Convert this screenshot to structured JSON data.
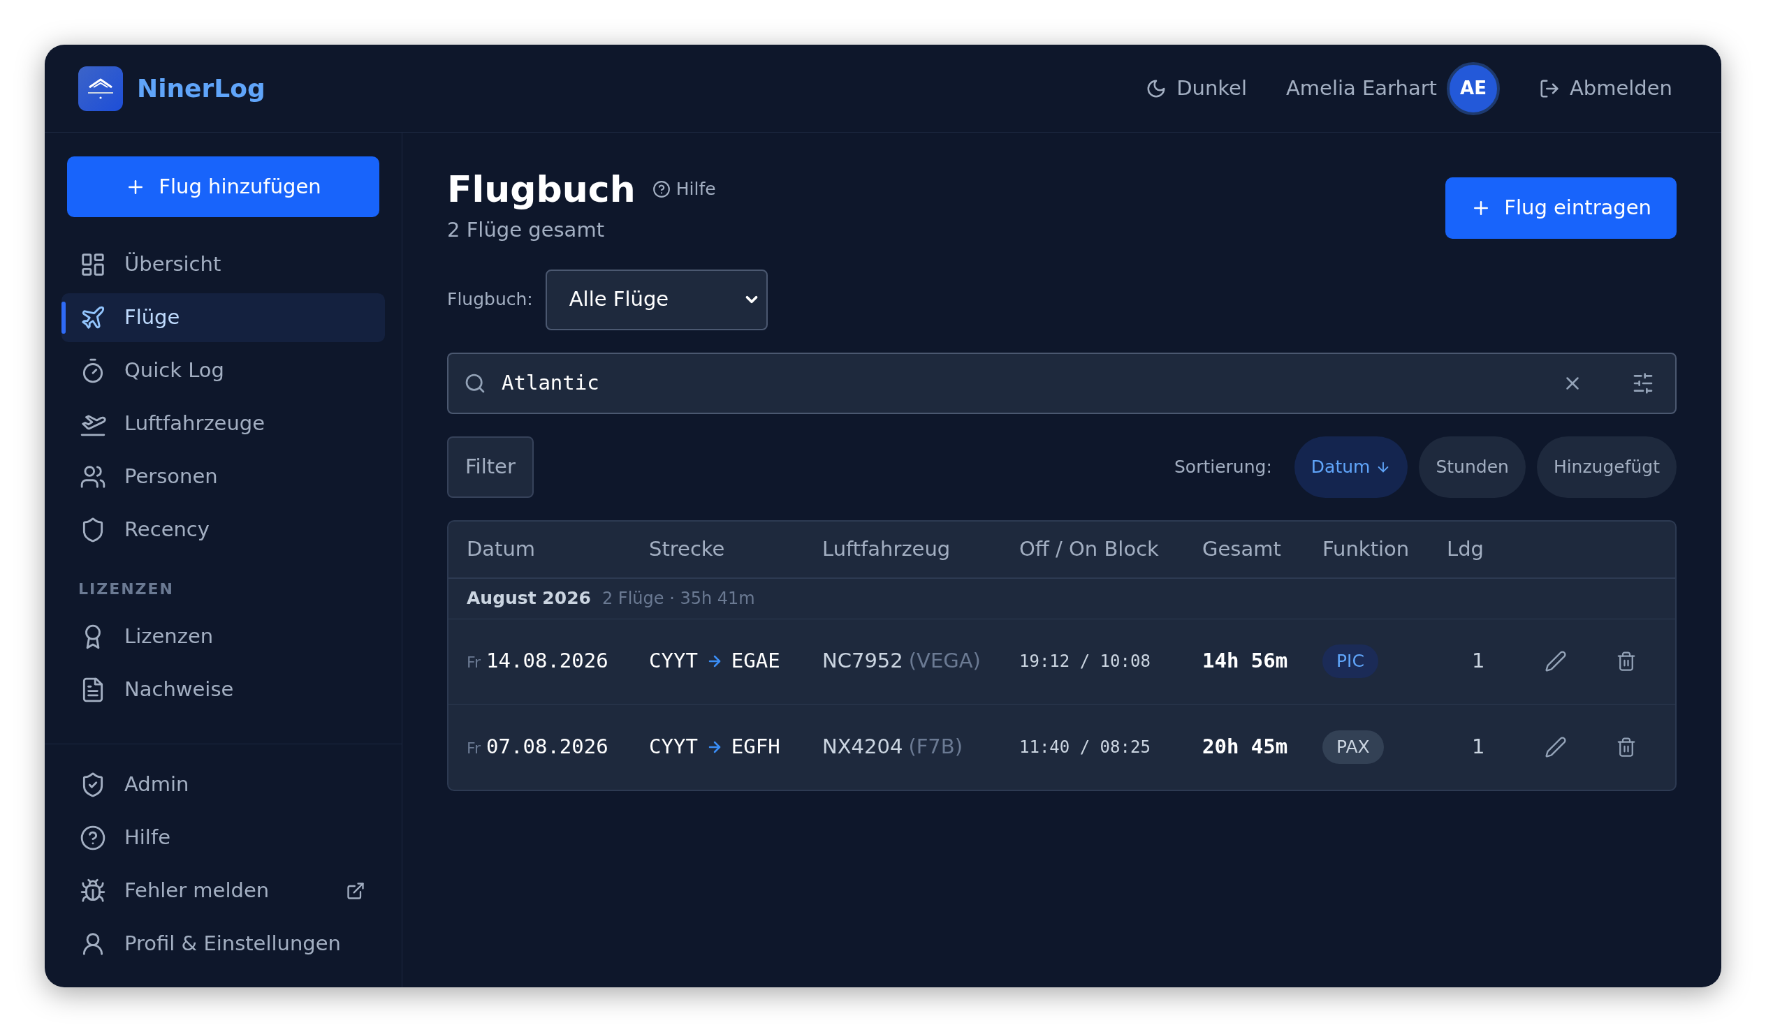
{
  "app": {
    "name": "NinerLog"
  },
  "header": {
    "theme_label": "Dunkel",
    "user_name": "Amelia Earhart",
    "avatar_initials": "AE",
    "logout_label": "Abmelden"
  },
  "sidebar": {
    "add_button": "Flug hinzufügen",
    "items": [
      {
        "label": "Übersicht",
        "selected": false
      },
      {
        "label": "Flüge",
        "selected": true
      },
      {
        "label": "Quick Log",
        "selected": false
      },
      {
        "label": "Luftfahrzeuge",
        "selected": false
      },
      {
        "label": "Personen",
        "selected": false
      },
      {
        "label": "Recency",
        "selected": false
      }
    ],
    "section_title": "LIZENZEN",
    "section_items": [
      {
        "label": "Lizenzen",
        "selected": false
      },
      {
        "label": "Nachweise",
        "selected": false
      }
    ],
    "bottom_items": [
      {
        "label": "Admin",
        "external": false
      },
      {
        "label": "Hilfe",
        "external": false
      },
      {
        "label": "Fehler melden",
        "external": true
      },
      {
        "label": "Profil & Einstellungen",
        "external": false
      }
    ]
  },
  "page": {
    "title": "Flugbuch",
    "help_link": "Hilfe",
    "subtitle": "2 Flüge gesamt",
    "add_button": "Flug eintragen",
    "logbook_label": "Flugbuch:",
    "logbook_value": "Alle Flüge",
    "search_value": "Atlantic",
    "filter_button": "Filter",
    "sort_label": "Sortierung:",
    "sort_options": [
      {
        "label": "Datum",
        "selected": true
      },
      {
        "label": "Stunden",
        "selected": false
      },
      {
        "label": "Hinzugefügt",
        "selected": false
      }
    ]
  },
  "table": {
    "columns": [
      "Datum",
      "Strecke",
      "Luftfahrzeug",
      "Off / On Block",
      "Gesamt",
      "Funktion",
      "Ldg"
    ],
    "group": {
      "title": "August 2026",
      "summary": "2 Flüge · 35h 41m"
    },
    "rows": [
      {
        "weekday": "Fr",
        "date": "14.08.2026",
        "from": "CYYT",
        "to": "EGAE",
        "registration": "NC7952",
        "type": "(VEGA)",
        "block": "19:12 / 10:08",
        "total": "14h 56m",
        "function": {
          "label": "PIC",
          "color": "#1b2b57"
        },
        "landings": "1"
      },
      {
        "weekday": "Fr",
        "date": "07.08.2026",
        "from": "CYYT",
        "to": "EGFH",
        "registration": "NX4204",
        "type": "(F7B)",
        "block": "11:40 / 08:25",
        "total": "20h 45m",
        "function": {
          "label": "PAX",
          "color": "#334155"
        },
        "landings": "1"
      }
    ]
  }
}
